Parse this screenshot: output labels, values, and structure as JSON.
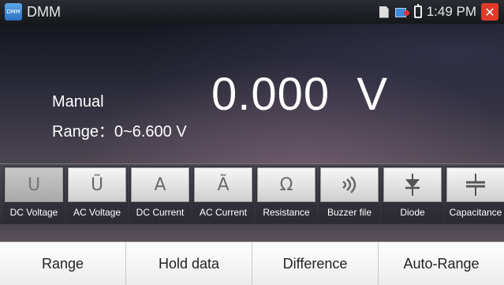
{
  "statusbar": {
    "app_icon_text": "DMM",
    "title": "DMM",
    "time": "1:49 PM",
    "close_glyph": "✕"
  },
  "display": {
    "reading": "0.000  V",
    "mode": "Manual",
    "range": "Range：0~6.600 V"
  },
  "functions": [
    {
      "glyph": "U",
      "label": "DC Voltage",
      "active": true
    },
    {
      "glyph": "Ũ",
      "label": "AC Voltage",
      "active": false
    },
    {
      "glyph": "A",
      "label": "DC Current",
      "active": false
    },
    {
      "glyph": "Ã",
      "label": "AC Current",
      "active": false
    },
    {
      "glyph": "Ω",
      "label": "Resistance",
      "active": false
    },
    {
      "glyph": "🔊",
      "label": "Buzzer file",
      "active": false
    },
    {
      "glyph": "⊳",
      "label": "Diode",
      "active": false
    },
    {
      "glyph": "⊣⊢",
      "label": "Capacitance",
      "active": false
    }
  ],
  "bottom": {
    "range": "Range",
    "hold": "Hold data",
    "difference": "Difference",
    "auto_range": "Auto-Range"
  }
}
